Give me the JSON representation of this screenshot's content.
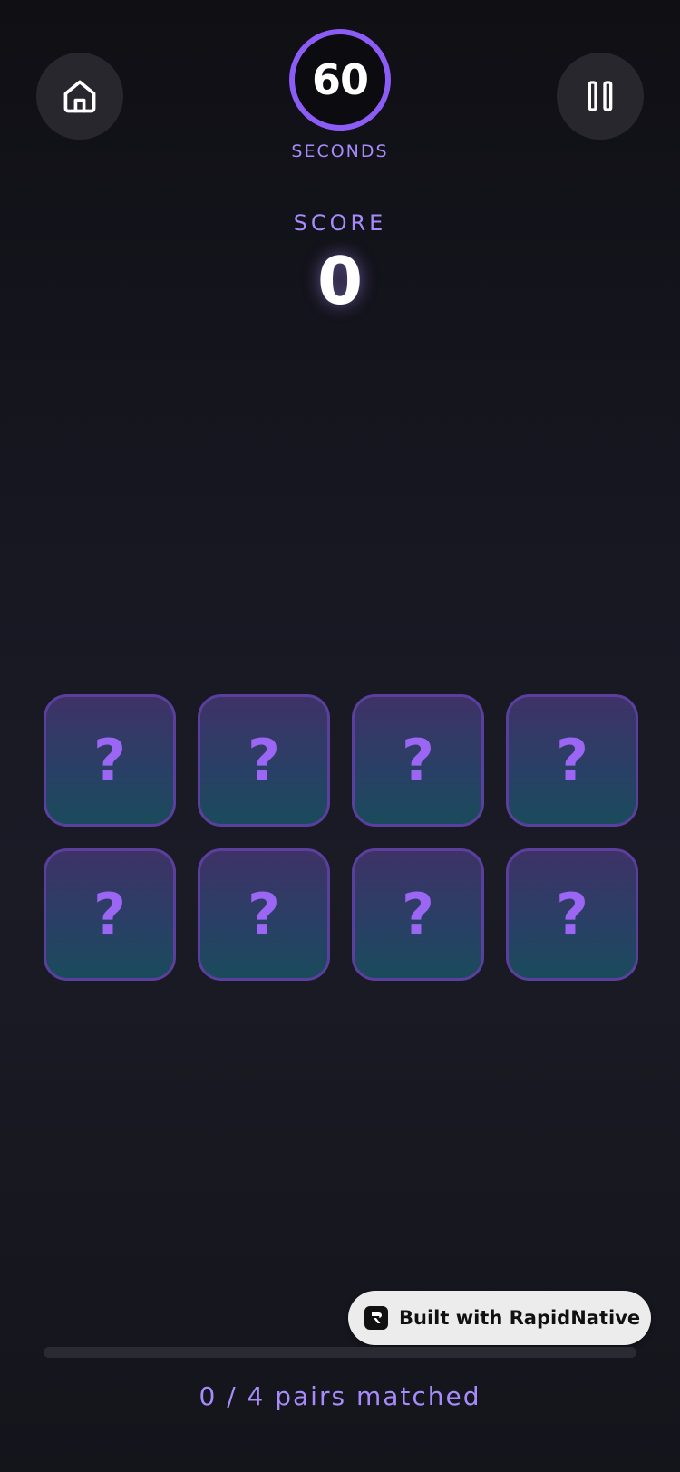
{
  "header": {
    "home_icon": "home-icon",
    "pause_icon": "pause-icon",
    "timer": {
      "value": "60",
      "label": "SECONDS"
    }
  },
  "score": {
    "label": "SCORE",
    "value": "0"
  },
  "cards": [
    {
      "face": "?"
    },
    {
      "face": "?"
    },
    {
      "face": "?"
    },
    {
      "face": "?"
    },
    {
      "face": "?"
    },
    {
      "face": "?"
    },
    {
      "face": "?"
    },
    {
      "face": "?"
    }
  ],
  "badge": {
    "text": "Built with RapidNative",
    "icon": "rapidnative-logo-icon"
  },
  "progress": {
    "matched": 0,
    "total": 4,
    "fraction": 0,
    "text": "0 / 4 pairs matched"
  },
  "colors": {
    "accent": "#8b5cf6",
    "accent_light": "#a78bfa",
    "background": "#16161f",
    "button_bg": "#27272d"
  }
}
